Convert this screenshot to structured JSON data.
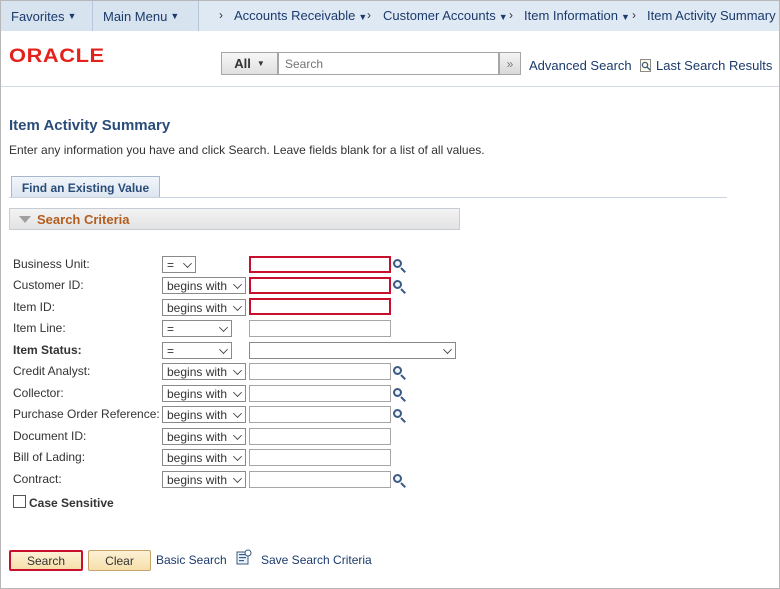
{
  "nav": {
    "favorites": "Favorites",
    "main_menu": "Main Menu",
    "breadcrumbs": [
      "Accounts Receivable",
      "Customer Accounts",
      "Item Information",
      "Item Activity Summary"
    ]
  },
  "header": {
    "logo": "ORACLE",
    "search_scope": "All",
    "search_placeholder": "Search",
    "advanced_search": "Advanced Search",
    "last_search_results": "Last Search Results"
  },
  "page": {
    "title": "Item Activity Summary",
    "instructions": "Enter any information you have and click Search. Leave fields blank for a list of all values.",
    "tab_label": "Find an Existing Value",
    "section_label": "Search Criteria"
  },
  "criteria": [
    {
      "label": "Business Unit:",
      "operator": "=",
      "value": ""
    },
    {
      "label": "Customer ID:",
      "operator": "begins with",
      "value": ""
    },
    {
      "label": "Item ID:",
      "operator": "begins with",
      "value": ""
    },
    {
      "label": "Item Line:",
      "operator": "=",
      "value": ""
    },
    {
      "label": "Item Status:",
      "operator": "=",
      "value": ""
    },
    {
      "label": "Credit Analyst:",
      "operator": "begins with",
      "value": ""
    },
    {
      "label": "Collector:",
      "operator": "begins with",
      "value": ""
    },
    {
      "label": "Purchase Order Reference:",
      "operator": "begins with",
      "value": ""
    },
    {
      "label": "Document ID:",
      "operator": "begins with",
      "value": ""
    },
    {
      "label": "Bill of Lading:",
      "operator": "begins with",
      "value": ""
    },
    {
      "label": "Contract:",
      "operator": "begins with",
      "value": ""
    }
  ],
  "case_sensitive_label": "Case Sensitive",
  "buttons": {
    "search": "Search",
    "clear": "Clear",
    "basic_search": "Basic Search",
    "save_search_criteria": "Save Search Criteria"
  },
  "colors": {
    "required_border": "#c8102e",
    "link": "#1b3a6b",
    "section_label": "#b35d1e"
  }
}
